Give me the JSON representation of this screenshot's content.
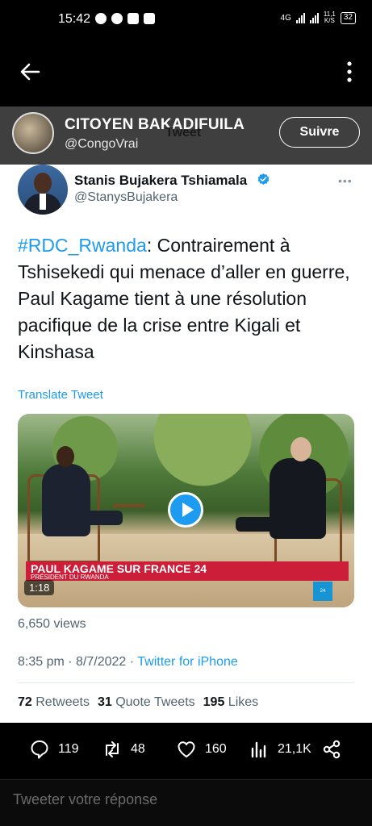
{
  "status_bar": {
    "time": "15:42",
    "network": "4G",
    "net_speed_value": "11,1",
    "net_speed_unit": "K/S",
    "battery": "32"
  },
  "retweeter": {
    "name": "CITOYEN BAKADIFUILA",
    "handle": "@CongoVrai",
    "page_title": "Tweet",
    "follow_label": "Suivre"
  },
  "tweet": {
    "author_name": "Stanis Bujakera Tshiamala",
    "author_handle": "@StanysBujakera",
    "hashtag": "#RDC_Rwanda",
    "text": ": Contrairement à Tshisekedi qui menace d’aller en guerre, Paul Kagame tient à une résolution pacifique de la crise entre Kigali et Kinshasa",
    "translate_label": "Translate Tweet",
    "video": {
      "lower_third_main": "PAUL KAGAME SUR FRANCE 24",
      "lower_third_sub": "PRÉSIDENT DU RWANDA",
      "channel_logo": "24",
      "duration": "1:18"
    },
    "views": "6,650 views",
    "time": "8:35 pm",
    "date": "8/7/2022",
    "separator": "·",
    "source": "Twitter for iPhone",
    "stats": {
      "retweets_count": "72",
      "retweets_label": "Retweets",
      "quotes_count": "31",
      "quotes_label": "Quote Tweets",
      "likes_count": "195",
      "likes_label": "Likes"
    }
  },
  "actions": {
    "replies": "119",
    "retweets": "48",
    "likes": "160",
    "views": "21,1K"
  },
  "reply_box": {
    "placeholder": "Tweeter votre réponse"
  },
  "colors": {
    "accent": "#1d9bf0",
    "retweeter_bar": "#3f3f3f",
    "lower_third": "#cc1e38"
  },
  "icons": [
    "back-arrow-icon",
    "more-vertical-icon",
    "verified-badge-icon",
    "more-horizontal-icon",
    "play-icon",
    "reply-icon",
    "retweet-icon",
    "like-icon",
    "views-icon",
    "share-icon"
  ]
}
